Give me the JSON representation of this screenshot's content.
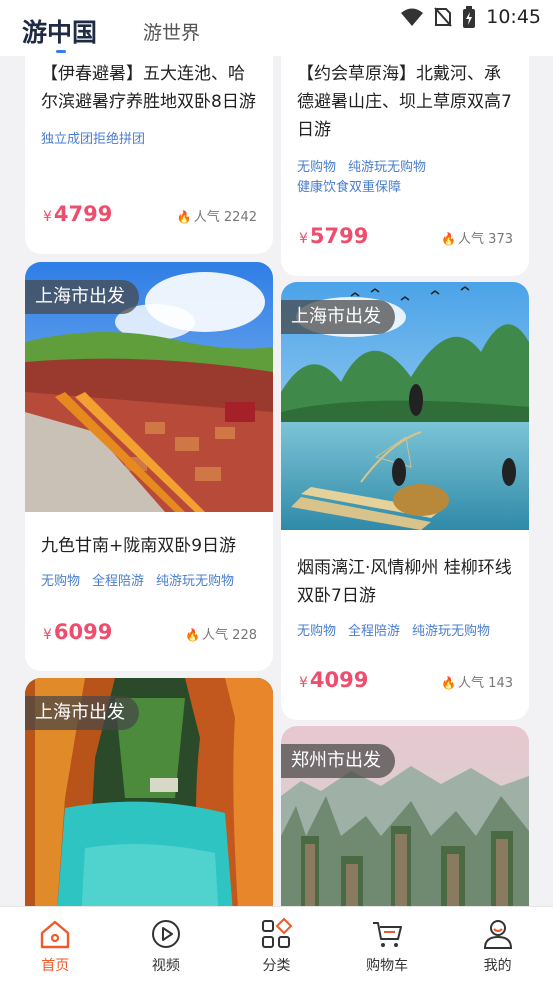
{
  "header": {
    "tab_active": "游中国",
    "tab_inactive": "游世界",
    "time": "10:45"
  },
  "cards": [
    {
      "title": "【伊春避暑】五大连池、哈尔滨避暑疗养胜地双卧8日游",
      "tags": [
        "独立成团拒绝拼团"
      ],
      "currency": "¥",
      "price": "4799",
      "popularity": "人气 2242"
    },
    {
      "title": "【约会草原海】北戴河、承德避暑山庄、坝上草原双高7日游",
      "tags": [
        "无购物",
        "纯游玩无购物",
        "健康饮食双重保障"
      ],
      "currency": "¥",
      "price": "5799",
      "popularity": "人气 373"
    },
    {
      "departure": "上海市出发",
      "title": "九色甘南+陇南双卧9日游",
      "tags": [
        "无购物",
        "全程陪游",
        "纯游玩无购物"
      ],
      "currency": "¥",
      "price": "6099",
      "popularity": "人气 228"
    },
    {
      "departure": "上海市出发",
      "title": "烟雨漓江·风情柳州 桂柳环线双卧7日游",
      "tags": [
        "无购物",
        "全程陪游",
        "纯游玩无购物"
      ],
      "currency": "¥",
      "price": "4099",
      "popularity": "人气 143"
    },
    {
      "departure": "上海市出发"
    },
    {
      "departure": "郑州市出发"
    }
  ],
  "nav": [
    {
      "label": "首页",
      "icon": "home-icon",
      "active": true
    },
    {
      "label": "视频",
      "icon": "play-icon"
    },
    {
      "label": "分类",
      "icon": "category-icon"
    },
    {
      "label": "购物车",
      "icon": "cart-icon"
    },
    {
      "label": "我的",
      "icon": "profile-icon"
    }
  ],
  "colors": {
    "accent": "#f05a28",
    "price": "#ee4d6d",
    "tag": "#4a7ecf"
  }
}
